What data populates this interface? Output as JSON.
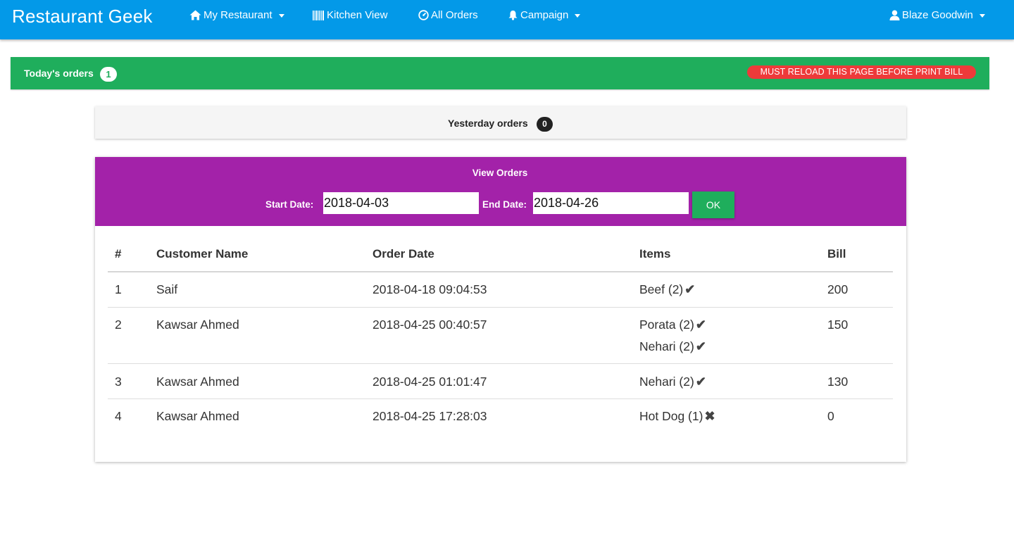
{
  "navbar": {
    "brand": "Restaurant Geek",
    "items": [
      {
        "label": "My Restaurant",
        "icon": "home-icon",
        "dropdown": true
      },
      {
        "label": "Kitchen View",
        "icon": "barcode-icon",
        "dropdown": false
      },
      {
        "label": "All Orders",
        "icon": "dashboard-icon",
        "dropdown": false
      },
      {
        "label": "Campaign",
        "icon": "bell-icon",
        "dropdown": true
      }
    ],
    "user": {
      "label": "Blaze Goodwin",
      "icon": "user-icon",
      "dropdown": true
    }
  },
  "today": {
    "label": "Today's orders",
    "count": "1",
    "warning": "MUST RELOAD THIS PAGE BEFORE PRINT BILL"
  },
  "yesterday": {
    "label": "Yesterday orders",
    "count": "0"
  },
  "view_orders": {
    "title": "View Orders",
    "start_label": "Start Date:",
    "start_value": "2018-04-03",
    "end_label": "End Date:",
    "end_value": "2018-04-26",
    "ok_label": "OK"
  },
  "table": {
    "headers": [
      "#",
      "Customer Name",
      "Order Date",
      "Items",
      "Bill"
    ],
    "rows": [
      {
        "num": "1",
        "customer": "Saif",
        "date": "2018-04-18 09:04:53",
        "items": [
          {
            "name": "Beef (2)",
            "status": "✔"
          }
        ],
        "bill": "200"
      },
      {
        "num": "2",
        "customer": "Kawsar Ahmed",
        "date": "2018-04-25 00:40:57",
        "items": [
          {
            "name": "Porata (2)",
            "status": "✔"
          },
          {
            "name": "Nehari (2)",
            "status": "✔"
          }
        ],
        "bill": "150"
      },
      {
        "num": "3",
        "customer": "Kawsar Ahmed",
        "date": "2018-04-25 01:01:47",
        "items": [
          {
            "name": "Nehari (2)",
            "status": "✔"
          }
        ],
        "bill": "130"
      },
      {
        "num": "4",
        "customer": "Kawsar Ahmed",
        "date": "2018-04-25 17:28:03",
        "items": [
          {
            "name": "Hot Dog (1)",
            "status": "✖"
          }
        ],
        "bill": "0"
      }
    ]
  },
  "colors": {
    "navbar": "#0399e8",
    "today_bar": "#1fae5c",
    "warning": "#ee3a3a",
    "panel_head": "#a322a9",
    "ok_button": "#1fae5c"
  }
}
